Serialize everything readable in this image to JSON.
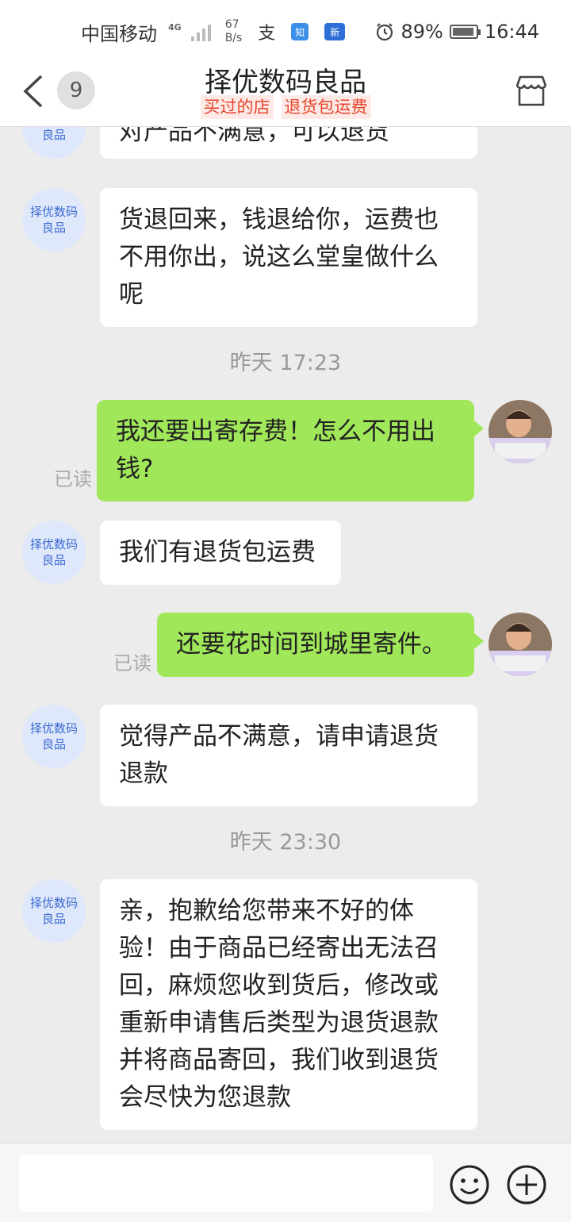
{
  "status_bar": {
    "carrier": "中国移动",
    "network": "4G",
    "speed_value": "67",
    "speed_unit": "B/s",
    "battery": "89%",
    "time": "16:44",
    "app_icon_2": "知",
    "app_icon_3": "新"
  },
  "header": {
    "title": "择优数码良品",
    "unread_count": "9",
    "tags": [
      "买过的店",
      "退货包运费"
    ]
  },
  "messages": {
    "shop_name": "择优数码良品",
    "read_label": "已读",
    "m0": "对产品不满意，可以退货",
    "m1": "货退回来，钱退给你，运费也不用你出，说这么堂皇做什么呢",
    "t1": "昨天 17:23",
    "m2": "我还要出寄存费！怎么不用出钱?",
    "m3": "我们有退货包运费",
    "m4": "还要花时间到城里寄件。",
    "m5": "觉得产品不满意，请申请退货退款",
    "t2": "昨天 23:30",
    "m6": "亲，抱歉给您带来不好的体验！由于商品已经寄出无法召回，麻烦您收到货后，修改或重新申请售后类型为退货退款并将商品寄回，我们收到退货会尽快为您退款"
  },
  "input": {
    "value": "",
    "placeholder": ""
  },
  "icons": {
    "back": "chevron-left-icon",
    "shop": "store-icon",
    "emoji": "smiley-icon",
    "more": "plus-circle-icon"
  },
  "colors": {
    "my_bubble": "#a0e759",
    "tag_text": "#e8452c",
    "tag_bg": "#fde9e6",
    "shop_avatar_bg": "#dfe8fb"
  }
}
